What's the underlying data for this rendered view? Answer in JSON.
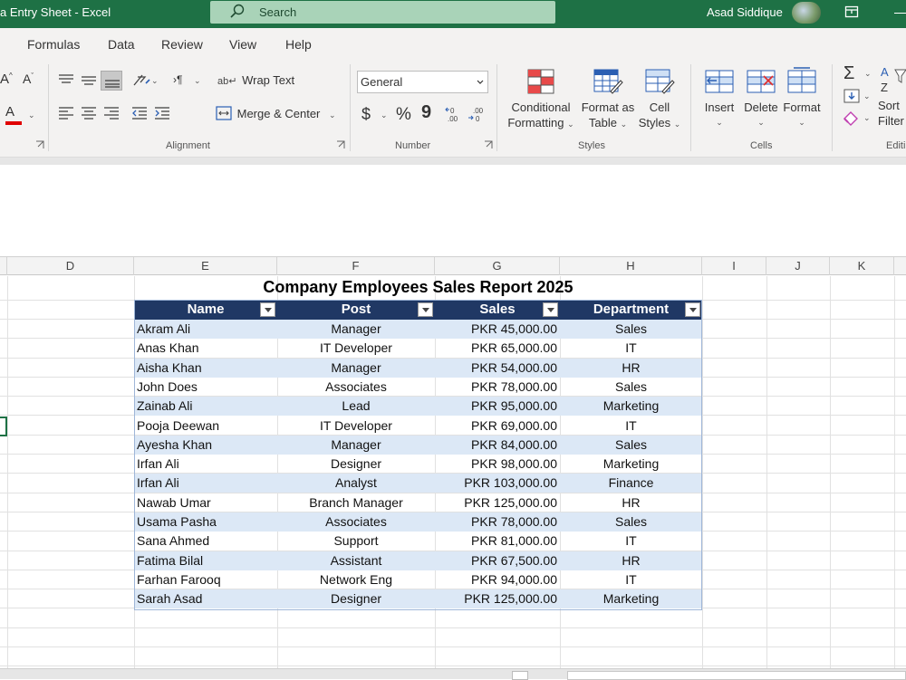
{
  "titlebar": {
    "document": "a Entry Sheet  -  Excel",
    "search_placeholder": "Search",
    "user": "Asad Siddique"
  },
  "menu": [
    "Formulas",
    "Data",
    "Review",
    "View",
    "Help"
  ],
  "ribbon": {
    "alignment": {
      "wrap_text": "Wrap Text",
      "merge_center": "Merge & Center",
      "group": "Alignment"
    },
    "number": {
      "format": "General",
      "group": "Number",
      "currency": "$",
      "percent": "%",
      "comma": "9"
    },
    "styles": {
      "conditional": [
        "Conditional",
        "Formatting"
      ],
      "format_as": [
        "Format as",
        "Table"
      ],
      "cell": [
        "Cell",
        "Styles"
      ],
      "group": "Styles"
    },
    "cells": {
      "insert": "Insert",
      "delete": "Delete",
      "format": "Format",
      "group": "Cells"
    },
    "editing": {
      "sort": "Sort",
      "filter": "Filter",
      "group": "Editi",
      "sigma": "Σ"
    },
    "font": {
      "grow": "A",
      "shrink": "A",
      "color": "A"
    }
  },
  "columns": [
    "D",
    "E",
    "F",
    "G",
    "H",
    "I",
    "J",
    "K"
  ],
  "report": {
    "title": "Company Employees Sales Report 2025",
    "headers": [
      "Name",
      "Post",
      "Sales",
      "Department"
    ],
    "rows": [
      [
        "Akram Ali",
        "Manager",
        "PKR 45,000.00",
        "Sales"
      ],
      [
        "Anas Khan",
        "IT Developer",
        "PKR 65,000.00",
        "IT"
      ],
      [
        "Aisha Khan",
        "Manager",
        "PKR 54,000.00",
        "HR"
      ],
      [
        "John Does",
        "Associates",
        "PKR 78,000.00",
        "Sales"
      ],
      [
        "Zainab Ali",
        "Lead",
        "PKR 95,000.00",
        "Marketing"
      ],
      [
        "Pooja Deewan",
        "IT Developer",
        "PKR 69,000.00",
        "IT"
      ],
      [
        "Ayesha Khan",
        "Manager",
        "PKR 84,000.00",
        "Sales"
      ],
      [
        "Irfan Ali",
        "Designer",
        "PKR 98,000.00",
        "Marketing"
      ],
      [
        "Irfan Ali",
        "Analyst",
        "PKR 103,000.00",
        "Finance"
      ],
      [
        "Nawab Umar",
        "Branch Manager",
        "PKR 125,000.00",
        "HR"
      ],
      [
        "Usama Pasha",
        "Associates",
        "PKR 78,000.00",
        "Sales"
      ],
      [
        "Sana Ahmed",
        "Support",
        "PKR 81,000.00",
        "IT"
      ],
      [
        "Fatima Bilal",
        "Assistant",
        "PKR 67,500.00",
        "HR"
      ],
      [
        "Farhan Farooq",
        "Network Eng",
        "PKR 94,000.00",
        "IT"
      ],
      [
        "Sarah Asad",
        "Designer",
        "PKR 125,000.00",
        "Marketing"
      ]
    ]
  },
  "colors": {
    "excel_green": "#1e7145",
    "table_header": "#203864",
    "table_band": "#dce8f6"
  }
}
